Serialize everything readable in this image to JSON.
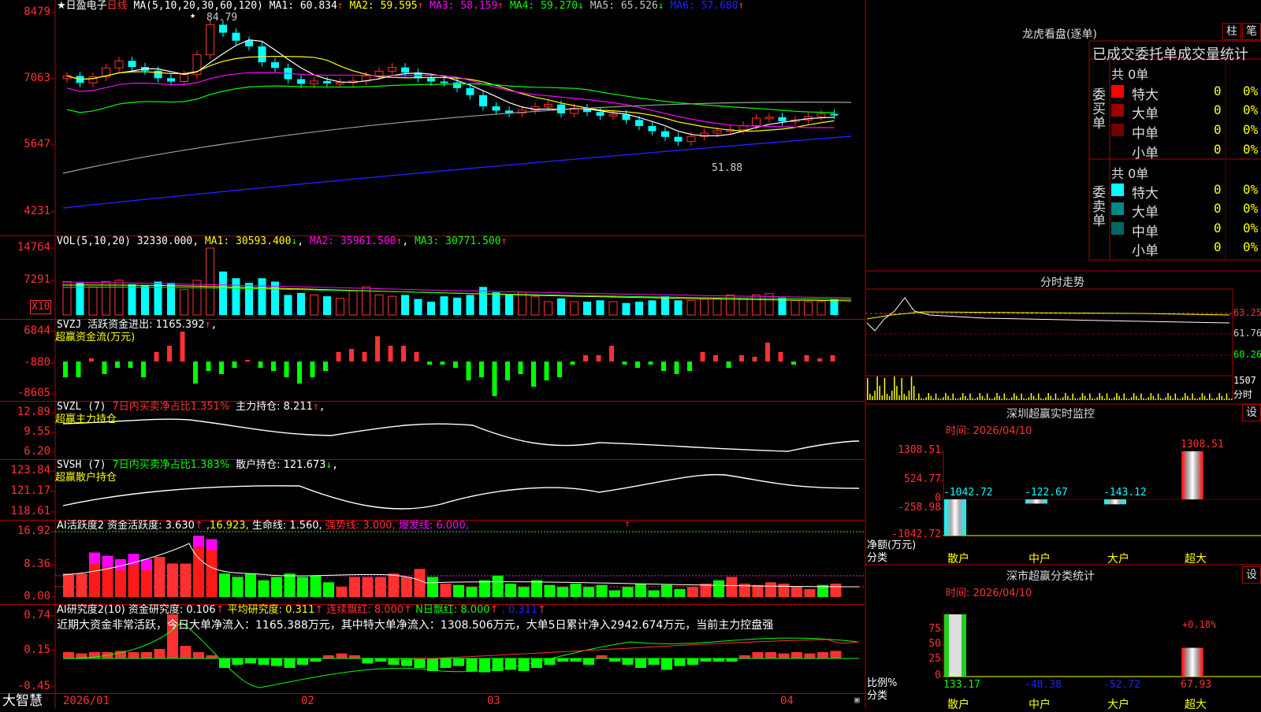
{
  "stock": {
    "name": "★日盈电子",
    "period": "日线"
  },
  "colors": {
    "up": "#ff3030",
    "down": "#00ffff",
    "frame": "#b00000",
    "green": "#00ff00",
    "yellow": "#ffff00",
    "magenta": "#ff00ff",
    "white": "#ffffff",
    "blue": "#2020ff",
    "gray": "#a0a0a0"
  },
  "main": {
    "yaxis": [
      "8479",
      "7063",
      "5647",
      "4231"
    ],
    "ma_head": "MA(5,10,20,30,60,120)",
    "ma": [
      {
        "label": "MA1: 60.834",
        "arrow": "↑",
        "color": "#ffffff"
      },
      {
        "label": "MA2: 59.595",
        "arrow": "↑",
        "color": "#ffff00"
      },
      {
        "label": "MA3: 58.159",
        "arrow": "↑",
        "color": "#ff00ff"
      },
      {
        "label": "MA4: 59.270",
        "arrow": "↓",
        "color": "#00ff00"
      },
      {
        "label": "MA5: 65.526",
        "arrow": "↓",
        "color": "#c0c0c0"
      },
      {
        "label": "MA6: 57.680",
        "arrow": "↑",
        "color": "#2020ff"
      }
    ],
    "high_label": "84.79",
    "low_label": "51.88"
  },
  "vol": {
    "yaxis": [
      "14764",
      "7291"
    ],
    "unit": "X10",
    "head": "VOL(5,10,20)",
    "value": "32330.000",
    "ma": [
      {
        "label": "MA1: 30593.400",
        "arrow": "↓",
        "color": "#ffff00"
      },
      {
        "label": "MA2: 35961.500",
        "arrow": "↑",
        "color": "#ff00ff"
      },
      {
        "label": "MA3: 30771.500",
        "arrow": "↑",
        "color": "#00ff00"
      }
    ]
  },
  "svzj": {
    "yaxis": [
      "6844",
      "-880",
      "-8605"
    ],
    "head": "SVZJ",
    "label": "活跃资金进出: 1165.392",
    "arrow": "↑",
    "sub": "超赢资金流(万元)"
  },
  "svzl": {
    "yaxis": [
      "12.89",
      "9.55",
      "6.20"
    ],
    "head": "SVZL (7)",
    "ratio": "7日内买卖净占比1.351%",
    "label": "主力持仓: 8.211",
    "arrow": "↑",
    "tail": ",",
    "sub": "超赢主力持仓"
  },
  "svsh": {
    "yaxis": [
      "123.84",
      "121.17",
      "118.61"
    ],
    "head": "SVSH (7)",
    "ratio": "7日内买卖净占比1.383%",
    "label": "散户持仓: 121.673",
    "arrow": "↓",
    "tail": ",",
    "sub": "超赢散户持仓"
  },
  "huoyue": {
    "yaxis": [
      "16.92",
      "8.36",
      "0.00"
    ],
    "head": "AI活跃度2",
    "items": [
      {
        "text": "资金活跃度: 3.630",
        "arrow": "↑",
        "color": "#ffffff"
      },
      {
        "text": ",16.923,",
        "arrow": "",
        "color": "#ffff00"
      },
      {
        "text": "生命线: 1.560,",
        "arrow": "",
        "color": "#ffffff"
      },
      {
        "text": "强势线: 3.000,",
        "arrow": "",
        "color": "#ff3030"
      },
      {
        "text": "爆发线: 6.000,",
        "arrow": "",
        "color": "#ff00ff"
      }
    ],
    "arrow_far": "↑"
  },
  "yanjiu": {
    "yaxis": [
      "0.74",
      "0.15",
      "-0.45"
    ],
    "head": "AI研究度2(10)",
    "items": [
      {
        "text": "资金研究度: 0.106",
        "arrow": "↑",
        "color": "#ffffff"
      },
      {
        "text": "平均研究度: 0.311",
        "arrow": "↑",
        "color": "#ffff00"
      },
      {
        "text": "连续飘红: 8.000",
        "arrow": "↑",
        "color": "#ff3030"
      },
      {
        "text": "N日飘红: 8.000",
        "arrow": "↑",
        "color": "#00ff00"
      },
      {
        "text": ", 0.311",
        "arrow": "↑",
        "color": "#2020ff"
      }
    ],
    "summary": "近期大资金非常活跃，今日大单净流入：1165.388万元，其中特大单净流入：1308.506万元，大单5日累计净入2942.674万元，当前主力控盘强"
  },
  "xaxis": {
    "brand": "大智慧",
    "labels": [
      "2026/01",
      "02",
      "03",
      "04"
    ]
  },
  "lhb": {
    "title": "龙虎看盘(逐单)",
    "btn1": "柱",
    "btn2": "笔",
    "subtitle": "已成交委托单成交量统计",
    "buy_side": "委买单",
    "sell_side": "委卖单",
    "buy_total": "共 0单",
    "sell_total": "共 0单",
    "buy_rows": [
      {
        "name": "特大",
        "count": "0",
        "pct": "0%",
        "color": "#ff0000"
      },
      {
        "name": "大单",
        "count": "0",
        "pct": "0%",
        "color": "#a00000"
      },
      {
        "name": "中单",
        "count": "0",
        "pct": "0%",
        "color": "#700000"
      },
      {
        "name": "小单",
        "count": "0",
        "pct": "0%",
        "color": ""
      }
    ],
    "sell_rows": [
      {
        "name": "特大",
        "count": "0",
        "pct": "0%",
        "color": "#00ffff"
      },
      {
        "name": "大单",
        "count": "0",
        "pct": "0%",
        "color": "#008888"
      },
      {
        "name": "中单",
        "count": "0",
        "pct": "0%",
        "color": "#006666"
      },
      {
        "name": "小单",
        "count": "0",
        "pct": "0%",
        "color": ""
      }
    ]
  },
  "fenshi": {
    "title": "分时走势",
    "yaxis": [
      "63.25",
      "61.76",
      "60.26"
    ],
    "vol": "1507",
    "vol_unit": "分时"
  },
  "monitor": {
    "title": "深圳超赢实时监控",
    "btn": "设",
    "time": "时间: 2026/04/10",
    "yaxis": [
      "1308.51",
      "524.77",
      "0",
      "-258.98",
      "-1042.72"
    ],
    "ylabel": "净额(万元)",
    "xlabel": "分类",
    "chart_data": {
      "type": "bar",
      "categories": [
        "散户",
        "中户",
        "大户",
        "超大"
      ],
      "values": [
        -1042.72,
        -122.67,
        -143.12,
        1308.51
      ],
      "value_labels": [
        "-1042.72",
        "-122.67",
        "-143.12",
        "1308.51"
      ],
      "ylim": [
        -1042.72,
        1308.51
      ]
    }
  },
  "classify": {
    "title": "深市超赢分类统计",
    "btn": "设",
    "time": "时间: 2026/04/10",
    "yaxis": [
      "75",
      "50",
      "25",
      "0"
    ],
    "ylabel": "比例%",
    "xlabel": "分类",
    "pct_label": "+0.18%",
    "chart_data": {
      "type": "bar",
      "categories": [
        "散户",
        "中户",
        "大户",
        "超大"
      ],
      "values": [
        133.17,
        -48.38,
        -52.72,
        67.93
      ],
      "value_labels": [
        "133.17",
        "-48.38",
        "-52.72",
        "67.93"
      ],
      "ylim": [
        0,
        75
      ]
    }
  }
}
